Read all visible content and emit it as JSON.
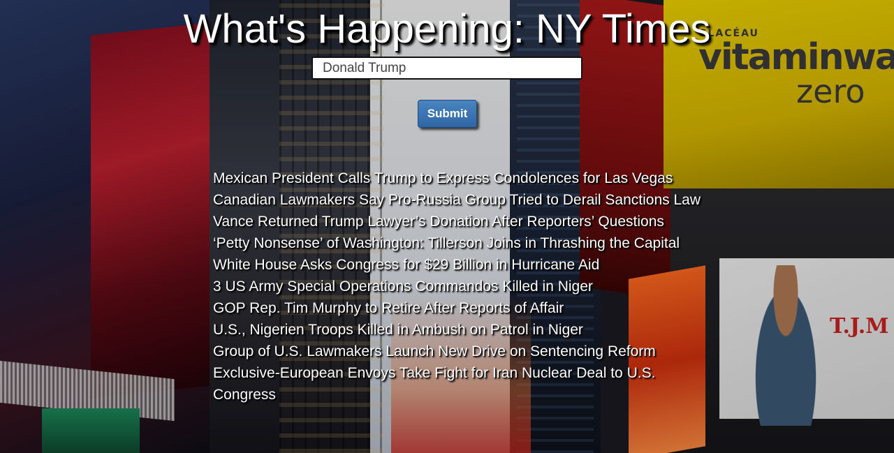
{
  "header": {
    "title": "What's Happening: NY Times"
  },
  "search": {
    "value": "Donald Trump",
    "placeholder": ""
  },
  "form": {
    "submit_label": "Submit"
  },
  "background": {
    "sign_brand_small": "GLACÉAU",
    "sign_brand_large": "vitaminwater",
    "sign_brand_sub": "zero",
    "poster_brand": "T.J.M"
  },
  "headlines": [
    "Mexican President Calls Trump to Express Condolences for Las Vegas",
    "Canadian Lawmakers Say Pro-Russia Group Tried to Derail Sanctions Law",
    "Vance Returned Trump Lawyer’s Donation After Reporters’ Questions",
    "‘Petty Nonsense’ of Washington: Tillerson Joins in Thrashing the Capital",
    "White House Asks Congress for $29 Billion in Hurricane Aid",
    "3 US Army Special Operations Commandos Killed in Niger",
    "GOP Rep. Tim Murphy to Retire After Reports of Affair",
    "U.S., Nigerien Troops Killed in Ambush on Patrol in Niger",
    "Group of U.S. Lawmakers Launch New Drive on Sentencing Reform",
    "Exclusive-European Envoys Take Fight for Iran Nuclear Deal to U.S. Congress"
  ]
}
